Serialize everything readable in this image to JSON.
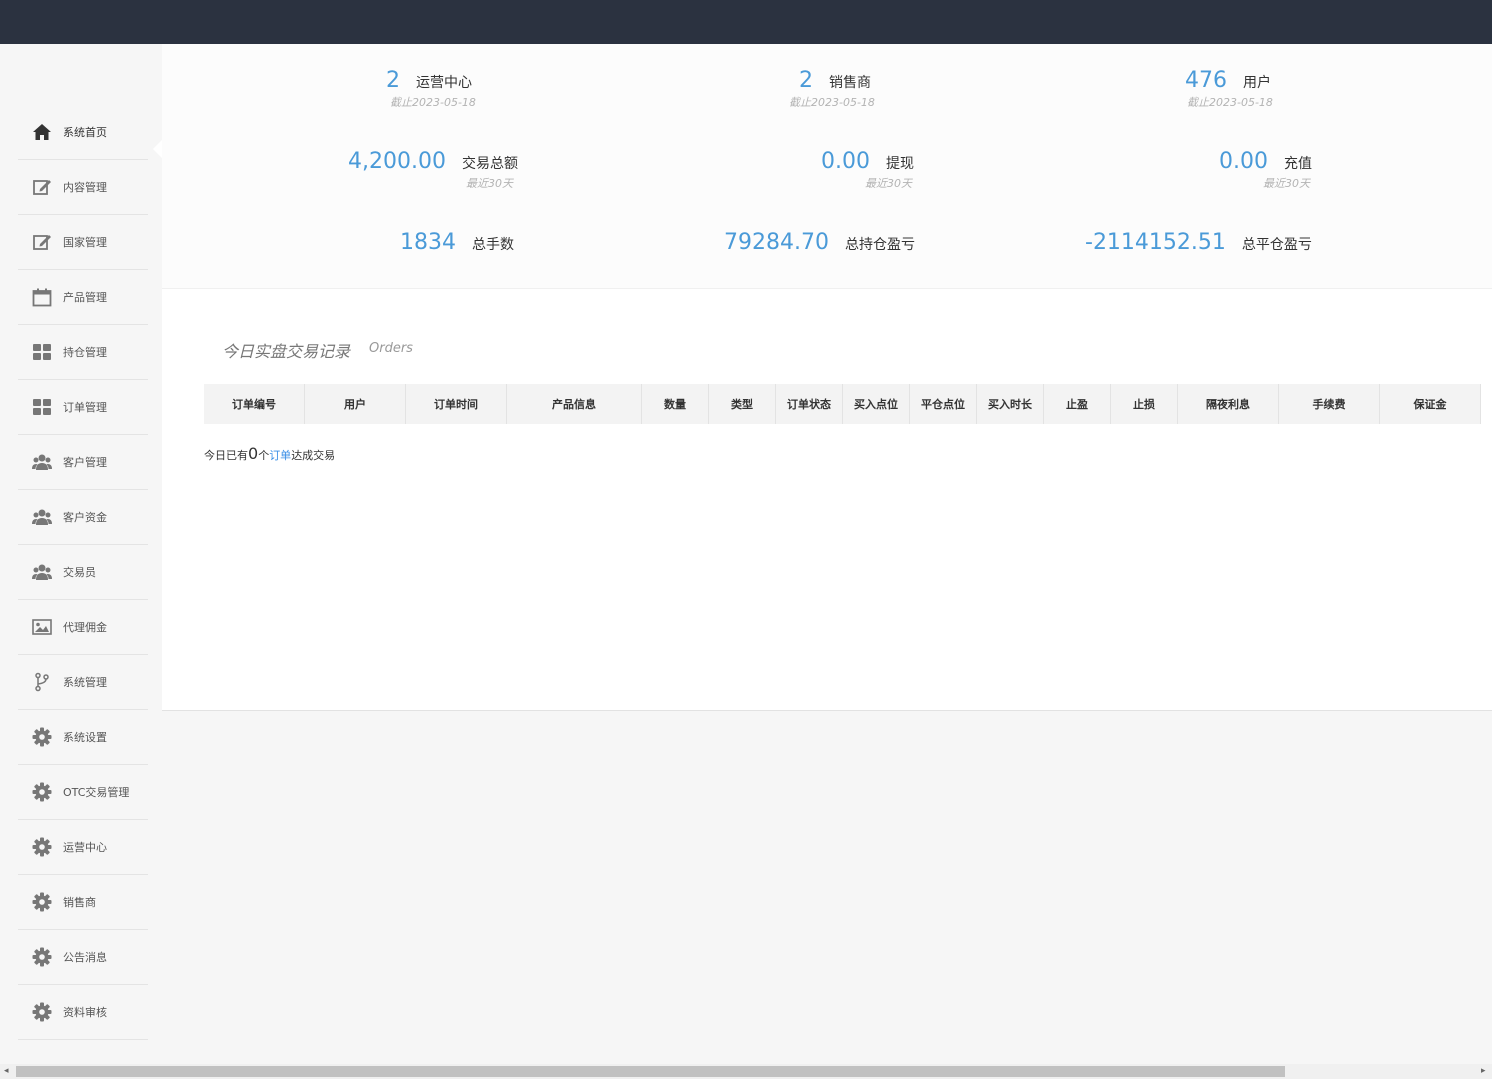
{
  "sidebar": {
    "items": [
      {
        "label": "系统首页",
        "icon": "home-icon",
        "active": true
      },
      {
        "label": "内容管理",
        "icon": "edit-icon"
      },
      {
        "label": "国家管理",
        "icon": "edit-icon"
      },
      {
        "label": "产品管理",
        "icon": "calendar-icon"
      },
      {
        "label": "持仓管理",
        "icon": "grid-icon"
      },
      {
        "label": "订单管理",
        "icon": "grid-icon"
      },
      {
        "label": "客户管理",
        "icon": "users-icon"
      },
      {
        "label": "客户资金",
        "icon": "users-icon"
      },
      {
        "label": "交易员",
        "icon": "users-icon"
      },
      {
        "label": "代理佣金",
        "icon": "image-icon"
      },
      {
        "label": "系统管理",
        "icon": "branch-icon"
      },
      {
        "label": "系统设置",
        "icon": "gear-icon"
      },
      {
        "label": "OTC交易管理",
        "icon": "gear-icon"
      },
      {
        "label": "运营中心",
        "icon": "gear-icon"
      },
      {
        "label": "销售商",
        "icon": "gear-icon"
      },
      {
        "label": "公告消息",
        "icon": "gear-icon"
      },
      {
        "label": "资料审核",
        "icon": "gear-icon"
      }
    ]
  },
  "stats": [
    {
      "value": "2",
      "label": "运营中心",
      "sub": "截止2023-05-18"
    },
    {
      "value": "2",
      "label": "销售商",
      "sub": "截止2023-05-18"
    },
    {
      "value": "476",
      "label": "用户",
      "sub": "截止2023-05-18"
    },
    {
      "value": "4,200.00",
      "label": "交易总额",
      "sub": "最近30天"
    },
    {
      "value": "0.00",
      "label": "提现",
      "sub": "最近30天"
    },
    {
      "value": "0.00",
      "label": "充值",
      "sub": "最近30天"
    },
    {
      "value": "1834",
      "label": "总手数",
      "sub": ""
    },
    {
      "value": "79284.70",
      "label": "总持仓盈亏",
      "sub": ""
    },
    {
      "value": "-2114152.51",
      "label": "总平仓盈亏",
      "sub": ""
    }
  ],
  "orders": {
    "title": "今日实盘交易记录",
    "subtitle": "Orders",
    "columns": [
      "订单编号",
      "用户",
      "订单时间",
      "产品信息",
      "数量",
      "类型",
      "订单状态",
      "买入点位",
      "平仓点位",
      "买入时长",
      "止盈",
      "止损",
      "隔夜利息",
      "手续费",
      "保证金"
    ],
    "summary_prefix": "今日已有",
    "summary_count": "0",
    "summary_unit": "个",
    "summary_link": "订单",
    "summary_suffix": "达成交易"
  },
  "colors": {
    "accent": "#4a9ad8",
    "topbar": "#2b3240",
    "link": "#3a8ee6"
  }
}
